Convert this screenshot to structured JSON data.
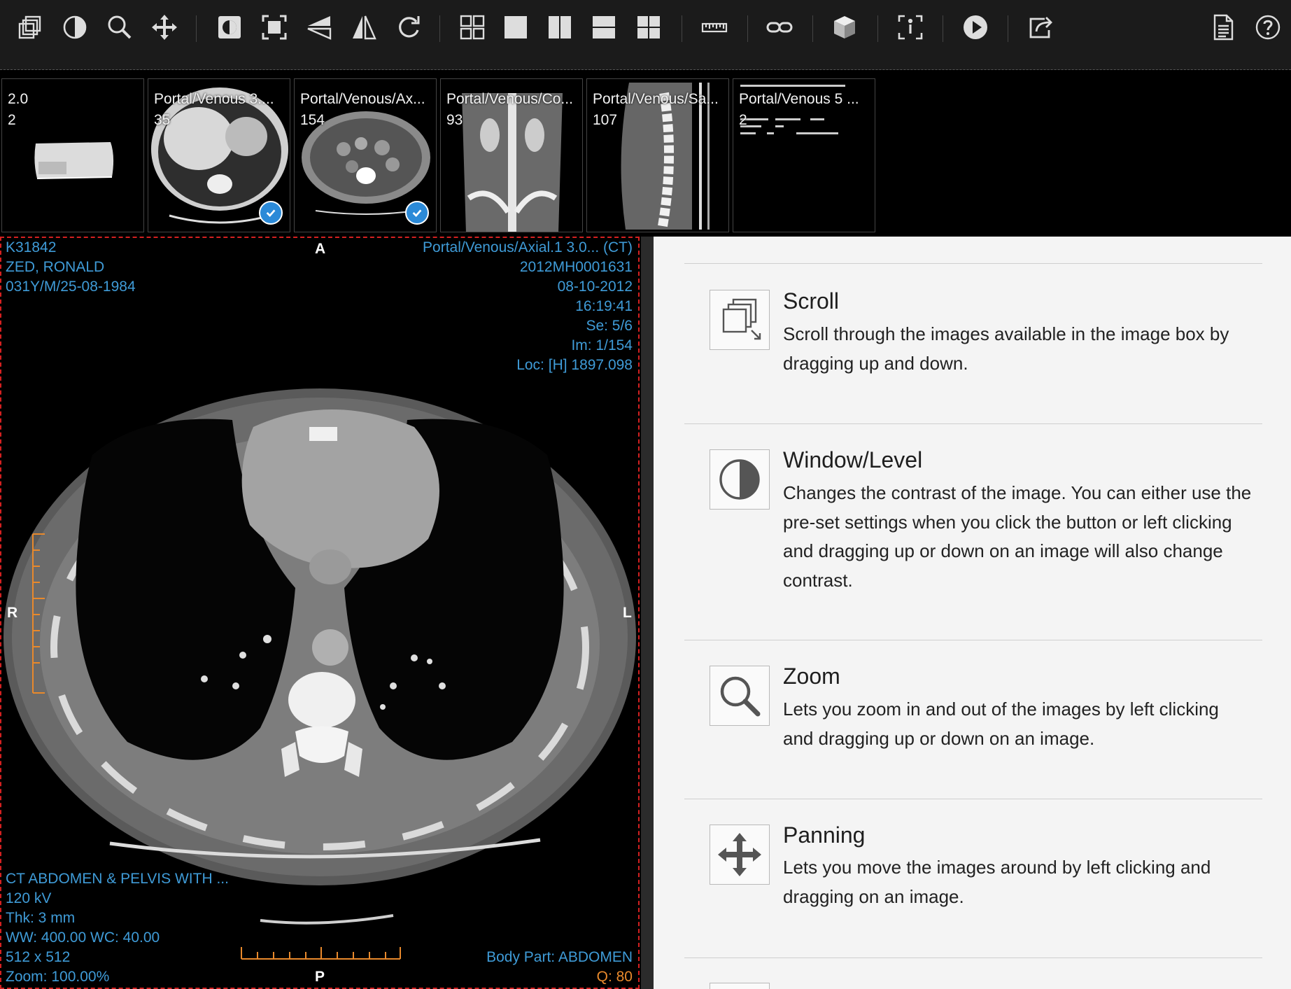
{
  "toolbar": {
    "buttons": [
      {
        "name": "scroll-icon",
        "tooltip": "Scroll"
      },
      {
        "name": "window-level-icon",
        "tooltip": "Window/Level"
      },
      {
        "name": "zoom-icon",
        "tooltip": "Zoom"
      },
      {
        "name": "pan-icon",
        "tooltip": "Panning"
      },
      {
        "name": "invert-icon"
      },
      {
        "name": "fit-icon"
      },
      {
        "name": "flip-horizontal-icon"
      },
      {
        "name": "flip-vertical-icon"
      },
      {
        "name": "rotate-icon"
      },
      {
        "name": "layout-grid-icon"
      },
      {
        "name": "layout-1x1-icon"
      },
      {
        "name": "layout-1x2-icon"
      },
      {
        "name": "layout-2x1-icon"
      },
      {
        "name": "layout-2x2-icon"
      },
      {
        "name": "ruler-icon"
      },
      {
        "name": "link-icon"
      },
      {
        "name": "3d-box-icon"
      },
      {
        "name": "info-frame-icon"
      },
      {
        "name": "play-icon"
      },
      {
        "name": "share-icon"
      },
      {
        "name": "report-icon"
      },
      {
        "name": "help-icon"
      }
    ]
  },
  "thumbnails": [
    {
      "line1": "2.0",
      "line2": "2",
      "selected": false
    },
    {
      "line1": "Portal/Venous 3....",
      "line2": "35",
      "selected": true
    },
    {
      "line1": "Portal/Venous/Ax...",
      "line2": "154",
      "selected": true
    },
    {
      "line1": "Portal/Venous/Co...",
      "line2": "93",
      "selected": false
    },
    {
      "line1": "Portal/Venous/Sa...",
      "line2": "107",
      "selected": false
    },
    {
      "line1": "Portal/Venous 5 ...",
      "line2": "2",
      "selected": false
    }
  ],
  "viewer": {
    "top_left": {
      "patient_id": "K31842",
      "patient_name": "ZED, RONALD",
      "patient_info": "031Y/M/25-08-1984"
    },
    "top_right": {
      "series": "Portal/Venous/Axial.1 3.0... (CT)",
      "accession": "2012MH0001631",
      "date": "08-10-2012",
      "time": "16:19:41",
      "series_no": "Se: 5/6",
      "image_no": "Im: 1/154",
      "location": "Loc: [H] 1897.098"
    },
    "bottom_left": {
      "study": "CT ABDOMEN & PELVIS WITH ...",
      "kv": "120 kV",
      "thickness": "Thk: 3 mm",
      "window": "WW: 400.00 WC: 40.00",
      "matrix": "512 x 512",
      "zoom": "Zoom: 100.00%"
    },
    "bottom_right": {
      "body_part": "Body Part: ABDOMEN",
      "quality": "Q: 80"
    },
    "orientation": {
      "top": "A",
      "bottom": "P",
      "left": "R",
      "right": "L"
    }
  },
  "help": {
    "items": [
      {
        "icon": "scroll-icon",
        "title": "Scroll",
        "description": "Scroll through the images available in the image box by dragging up and down."
      },
      {
        "icon": "window-level-icon",
        "title": "Window/Level",
        "description": "Changes the contrast of the image. You can either use the pre-set settings when you click the button or left clicking and dragging up or down on an image will also change contrast."
      },
      {
        "icon": "zoom-icon",
        "title": "Zoom",
        "description": "Lets you zoom in and out of the images by left clicking and dragging up or down on an image."
      },
      {
        "icon": "pan-icon",
        "title": "Panning",
        "description": "Lets you move the images around by left clicking and dragging on an image."
      }
    ]
  },
  "colors": {
    "overlay_text": "#3f9bd7",
    "overlay_orange": "#e8892c",
    "selection_border": "#d42020",
    "check_badge": "#2b8ad8"
  }
}
